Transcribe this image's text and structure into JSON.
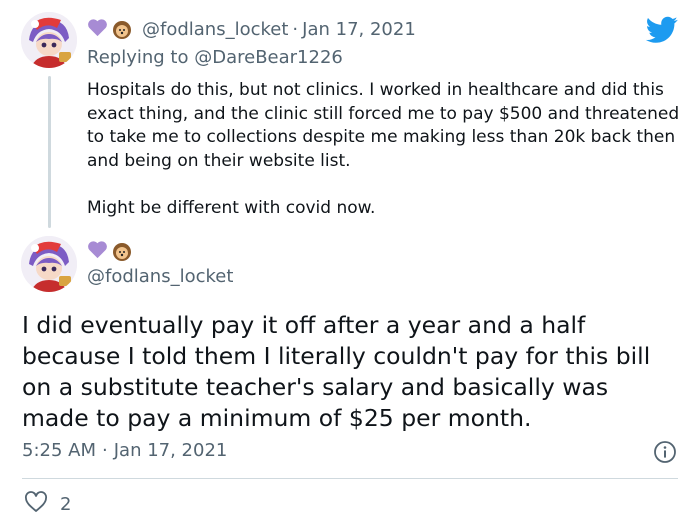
{
  "colors": {
    "twitter_blue": "#1d9bf0",
    "text": "#0f1419",
    "muted": "#536471",
    "heart_purple": "#a78bd4",
    "line": "#cfd9de"
  },
  "reply_tweet": {
    "author_handle": "@fodlans_locket",
    "separator": "·",
    "date": "Jan 17, 2021",
    "replying_prefix": "Replying to",
    "replying_to": "@DareBear1226",
    "paragraph1": "Hospitals do this, but not clinics. I worked in healthcare and did this exact thing, and the clinic still forced me to pay $500 and threatened to take me to collections despite me making less than 20k back then and being on their website list.",
    "paragraph2": "Might be different with covid now.",
    "badge_icons": [
      "purple-heart-icon",
      "hedgehog-icon"
    ]
  },
  "main_tweet": {
    "author_handle": "@fodlans_locket",
    "text": "I did eventually pay it off after a year and a half because I told them I literally couldn't pay for this bill on a substitute teacher's salary and basically was made to pay a minimum of $25 per month.",
    "time": "5:25 AM",
    "separator": "·",
    "date": "Jan 17, 2021",
    "like_count": "2",
    "badge_icons": [
      "purple-heart-icon",
      "hedgehog-icon"
    ]
  },
  "icons": {
    "brand": "twitter-bird-icon",
    "info": "info-icon",
    "like": "heart-outline-icon"
  }
}
